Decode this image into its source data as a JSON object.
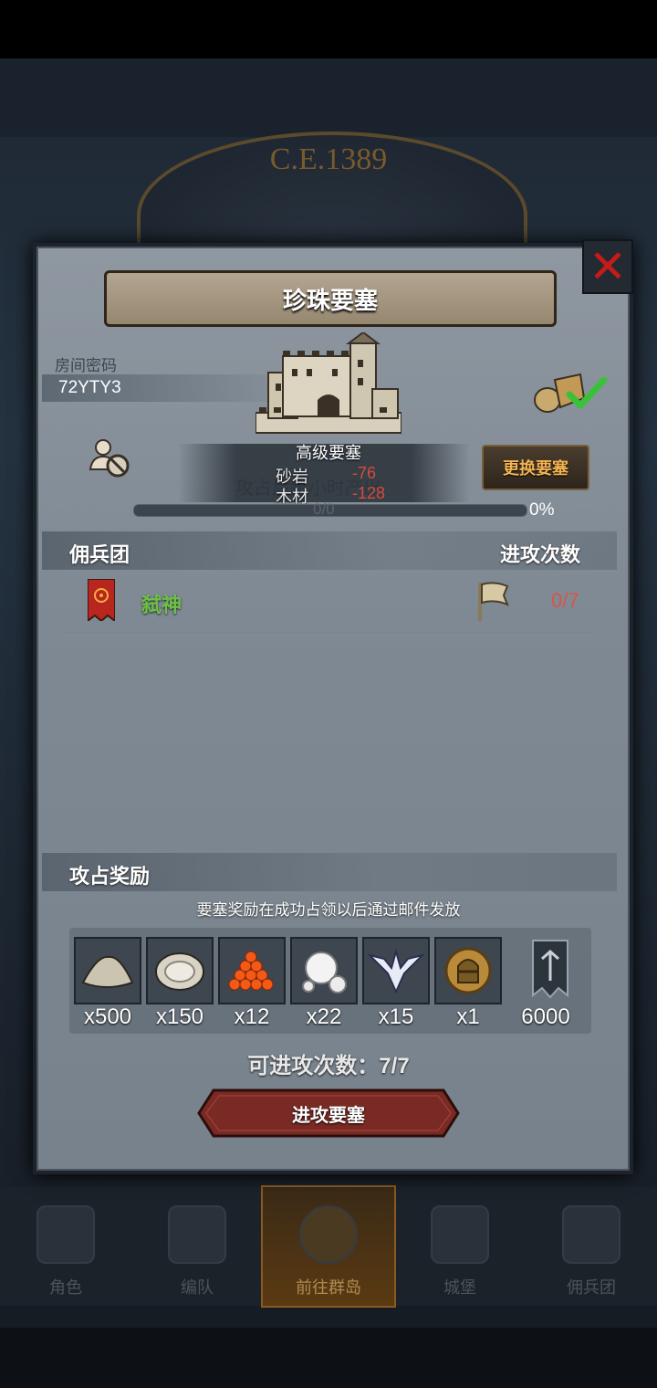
{
  "background": {
    "year": "C.E.1389"
  },
  "nav": {
    "items": [
      {
        "label": "角色"
      },
      {
        "label": "编队"
      },
      {
        "label": "前往群岛",
        "active": true
      },
      {
        "label": "城堡"
      },
      {
        "label": "佣兵团"
      }
    ]
  },
  "dialog": {
    "title": "珍珠要塞",
    "room": {
      "label": "房间密码",
      "code": "72YTY3"
    },
    "fortress": {
      "level": "高级要塞",
      "ghost_text": "攻占后每小时产出",
      "resources": [
        {
          "name": "砂岩",
          "value": "-76"
        },
        {
          "name": "木材",
          "value": "-128"
        }
      ]
    },
    "change_button": "更换要塞",
    "progress": {
      "text": "0/0",
      "percent": "0%",
      "fraction": 0
    },
    "mercenary": {
      "header": "佣兵团",
      "attacks_header": "进攻次数",
      "entries": [
        {
          "name": "弑神",
          "attacks": "0/7"
        }
      ]
    },
    "reward": {
      "header": "攻占奖励",
      "note": "要塞奖励在成功占领以后通过邮件发放",
      "items": [
        {
          "icon": "sand-pile-icon",
          "qty": "x500"
        },
        {
          "icon": "oyster-icon",
          "qty": "x150"
        },
        {
          "icon": "fish-roe-icon",
          "qty": "x12"
        },
        {
          "icon": "pearl-icon",
          "qty": "x22"
        },
        {
          "icon": "wing-emblem-icon",
          "qty": "x15"
        },
        {
          "icon": "knight-helmet-coin-icon",
          "qty": "x1"
        },
        {
          "icon": "guild-banner-icon",
          "qty": "6000"
        }
      ]
    },
    "attempts": "可进攻次数：7/7",
    "attack_button": "进攻要塞"
  },
  "colors": {
    "panel": "#8f98a1",
    "guild_name": "#6ec04b",
    "negative": "#d94a3a",
    "change_button_text": "#f1b352",
    "attack_button": "#7a2a24"
  }
}
